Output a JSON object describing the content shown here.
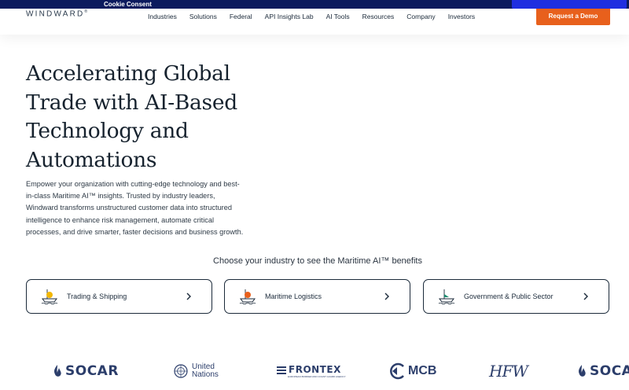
{
  "cookie": {
    "title": "Cookie Consent"
  },
  "header": {
    "logo": "WINDWARD",
    "logo_mark": "®",
    "nav": [
      "Industries",
      "Solutions",
      "Federal",
      "API Insights Lab",
      "AI Tools",
      "Resources",
      "Company",
      "Investors"
    ],
    "cta": "Request a Demo"
  },
  "hero": {
    "title_lines": [
      "Accelerating Global",
      "Trade with AI-Based",
      "Technology and",
      "Automations"
    ],
    "description_lines": [
      "Empower your organization with cutting-edge technology and best-",
      "in-class Maritime AI™ insights. Trusted by industry leaders,",
      "Windward transforms unstructured customer data into structured",
      "intelligence to enhance risk management, automate critical",
      "processes, and drive smarter, faster decisions and business growth."
    ]
  },
  "industries": {
    "prompt": "Choose your industry to see the Maritime AI™ benefits",
    "cards": [
      {
        "label": "Trading & Shipping",
        "icon": "ship-icon",
        "accent": "#f2b705"
      },
      {
        "label": "Maritime Logistics",
        "icon": "ship-icon",
        "accent": "#e8601c"
      },
      {
        "label": "Government & Public Sector",
        "icon": "ship-icon",
        "accent": "#1a8a6e"
      }
    ]
  },
  "clients": {
    "socar": "SOCAR",
    "un_line1": "United",
    "un_line2": "Nations",
    "frontex": "FRONTEX",
    "frontex_sub": "EUROPEAN BORDER AND COAST GUARD AGENCY",
    "mcb": "MCB",
    "hfw": "HFW",
    "socar_repeat": "SOCA"
  },
  "colors": {
    "cta": "#e8601c",
    "cookie_bar": "#0c1b5e",
    "text": "#1b2a3a",
    "client_logo": "#2c3e6b"
  }
}
